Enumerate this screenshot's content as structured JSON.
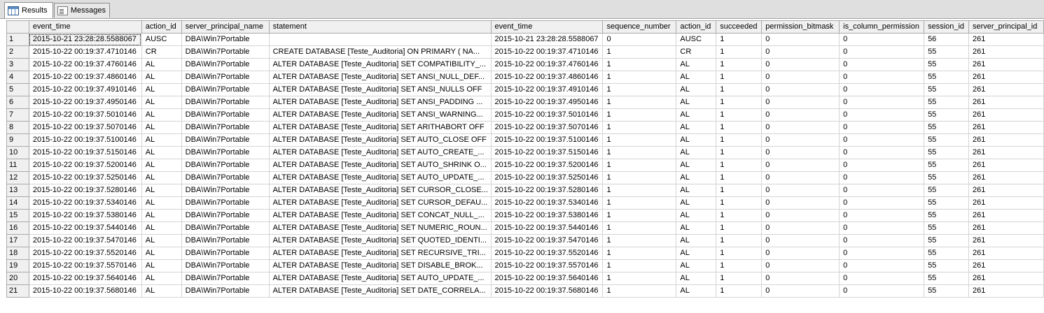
{
  "tabs": [
    {
      "label": "Results",
      "icon": "grid-icon"
    },
    {
      "label": "Messages",
      "icon": "messages-icon"
    }
  ],
  "columns": [
    "event_time",
    "action_id",
    "server_principal_name",
    "statement",
    "event_time",
    "sequence_number",
    "action_id",
    "succeeded",
    "permission_bitmask",
    "is_column_permission",
    "session_id",
    "server_principal_id"
  ],
  "rows": [
    [
      "1",
      "2015-10-21 23:28:28.5588067",
      "AUSC",
      "DBA\\Win7Portable",
      "",
      "2015-10-21 23:28:28.5588067",
      "0",
      "AUSC",
      "1",
      "0",
      "0",
      "56",
      "261"
    ],
    [
      "2",
      "2015-10-22 00:19:37.4710146",
      "CR",
      "DBA\\Win7Portable",
      "CREATE DATABASE [Teste_Auditoria] ON  PRIMARY   ( NA...",
      "2015-10-22 00:19:37.4710146",
      "1",
      "CR",
      "1",
      "0",
      "0",
      "55",
      "261"
    ],
    [
      "3",
      "2015-10-22 00:19:37.4760146",
      "AL",
      "DBA\\Win7Portable",
      "ALTER DATABASE [Teste_Auditoria] SET COMPATIBILITY_...",
      "2015-10-22 00:19:37.4760146",
      "1",
      "AL",
      "1",
      "0",
      "0",
      "55",
      "261"
    ],
    [
      "4",
      "2015-10-22 00:19:37.4860146",
      "AL",
      "DBA\\Win7Portable",
      "ALTER DATABASE [Teste_Auditoria] SET ANSI_NULL_DEF...",
      "2015-10-22 00:19:37.4860146",
      "1",
      "AL",
      "1",
      "0",
      "0",
      "55",
      "261"
    ],
    [
      "5",
      "2015-10-22 00:19:37.4910146",
      "AL",
      "DBA\\Win7Portable",
      "ALTER DATABASE [Teste_Auditoria] SET ANSI_NULLS OFF",
      "2015-10-22 00:19:37.4910146",
      "1",
      "AL",
      "1",
      "0",
      "0",
      "55",
      "261"
    ],
    [
      "6",
      "2015-10-22 00:19:37.4950146",
      "AL",
      "DBA\\Win7Portable",
      "ALTER DATABASE [Teste_Auditoria] SET ANSI_PADDING ...",
      "2015-10-22 00:19:37.4950146",
      "1",
      "AL",
      "1",
      "0",
      "0",
      "55",
      "261"
    ],
    [
      "7",
      "2015-10-22 00:19:37.5010146",
      "AL",
      "DBA\\Win7Portable",
      "ALTER DATABASE [Teste_Auditoria] SET ANSI_WARNING...",
      "2015-10-22 00:19:37.5010146",
      "1",
      "AL",
      "1",
      "0",
      "0",
      "55",
      "261"
    ],
    [
      "8",
      "2015-10-22 00:19:37.5070146",
      "AL",
      "DBA\\Win7Portable",
      "ALTER DATABASE [Teste_Auditoria] SET ARITHABORT OFF",
      "2015-10-22 00:19:37.5070146",
      "1",
      "AL",
      "1",
      "0",
      "0",
      "55",
      "261"
    ],
    [
      "9",
      "2015-10-22 00:19:37.5100146",
      "AL",
      "DBA\\Win7Portable",
      "ALTER DATABASE [Teste_Auditoria] SET AUTO_CLOSE OFF",
      "2015-10-22 00:19:37.5100146",
      "1",
      "AL",
      "1",
      "0",
      "0",
      "55",
      "261"
    ],
    [
      "10",
      "2015-10-22 00:19:37.5150146",
      "AL",
      "DBA\\Win7Portable",
      "ALTER DATABASE [Teste_Auditoria] SET AUTO_CREATE_...",
      "2015-10-22 00:19:37.5150146",
      "1",
      "AL",
      "1",
      "0",
      "0",
      "55",
      "261"
    ],
    [
      "11",
      "2015-10-22 00:19:37.5200146",
      "AL",
      "DBA\\Win7Portable",
      "ALTER DATABASE [Teste_Auditoria] SET AUTO_SHRINK O...",
      "2015-10-22 00:19:37.5200146",
      "1",
      "AL",
      "1",
      "0",
      "0",
      "55",
      "261"
    ],
    [
      "12",
      "2015-10-22 00:19:37.5250146",
      "AL",
      "DBA\\Win7Portable",
      "ALTER DATABASE [Teste_Auditoria] SET AUTO_UPDATE_...",
      "2015-10-22 00:19:37.5250146",
      "1",
      "AL",
      "1",
      "0",
      "0",
      "55",
      "261"
    ],
    [
      "13",
      "2015-10-22 00:19:37.5280146",
      "AL",
      "DBA\\Win7Portable",
      "ALTER DATABASE [Teste_Auditoria] SET CURSOR_CLOSE...",
      "2015-10-22 00:19:37.5280146",
      "1",
      "AL",
      "1",
      "0",
      "0",
      "55",
      "261"
    ],
    [
      "14",
      "2015-10-22 00:19:37.5340146",
      "AL",
      "DBA\\Win7Portable",
      "ALTER DATABASE [Teste_Auditoria] SET CURSOR_DEFAU...",
      "2015-10-22 00:19:37.5340146",
      "1",
      "AL",
      "1",
      "0",
      "0",
      "55",
      "261"
    ],
    [
      "15",
      "2015-10-22 00:19:37.5380146",
      "AL",
      "DBA\\Win7Portable",
      "ALTER DATABASE [Teste_Auditoria] SET CONCAT_NULL_...",
      "2015-10-22 00:19:37.5380146",
      "1",
      "AL",
      "1",
      "0",
      "0",
      "55",
      "261"
    ],
    [
      "16",
      "2015-10-22 00:19:37.5440146",
      "AL",
      "DBA\\Win7Portable",
      "ALTER DATABASE [Teste_Auditoria] SET NUMERIC_ROUN...",
      "2015-10-22 00:19:37.5440146",
      "1",
      "AL",
      "1",
      "0",
      "0",
      "55",
      "261"
    ],
    [
      "17",
      "2015-10-22 00:19:37.5470146",
      "AL",
      "DBA\\Win7Portable",
      "ALTER DATABASE [Teste_Auditoria] SET QUOTED_IDENTI...",
      "2015-10-22 00:19:37.5470146",
      "1",
      "AL",
      "1",
      "0",
      "0",
      "55",
      "261"
    ],
    [
      "18",
      "2015-10-22 00:19:37.5520146",
      "AL",
      "DBA\\Win7Portable",
      "ALTER DATABASE [Teste_Auditoria] SET RECURSIVE_TRI...",
      "2015-10-22 00:19:37.5520146",
      "1",
      "AL",
      "1",
      "0",
      "0",
      "55",
      "261"
    ],
    [
      "19",
      "2015-10-22 00:19:37.5570146",
      "AL",
      "DBA\\Win7Portable",
      "ALTER DATABASE [Teste_Auditoria] SET  DISABLE_BROK...",
      "2015-10-22 00:19:37.5570146",
      "1",
      "AL",
      "1",
      "0",
      "0",
      "55",
      "261"
    ],
    [
      "20",
      "2015-10-22 00:19:37.5640146",
      "AL",
      "DBA\\Win7Portable",
      "ALTER DATABASE [Teste_Auditoria] SET AUTO_UPDATE_...",
      "2015-10-22 00:19:37.5640146",
      "1",
      "AL",
      "1",
      "0",
      "0",
      "55",
      "261"
    ],
    [
      "21",
      "2015-10-22 00:19:37.5680146",
      "AL",
      "DBA\\Win7Portable",
      "ALTER DATABASE [Teste_Auditoria] SET DATE_CORRELA...",
      "2015-10-22 00:19:37.5680146",
      "1",
      "AL",
      "1",
      "0",
      "0",
      "55",
      "261"
    ]
  ]
}
